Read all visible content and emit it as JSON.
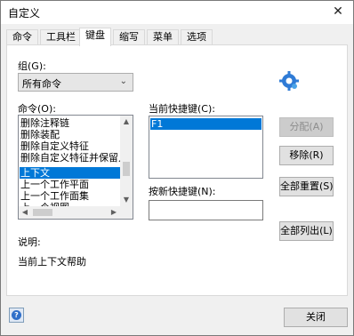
{
  "window": {
    "title": "自定义",
    "close_glyph": "✕"
  },
  "tabs": [
    {
      "label": "命令",
      "active": false
    },
    {
      "label": "工具栏",
      "active": false
    },
    {
      "label": "键盘",
      "active": true
    },
    {
      "label": "缩写",
      "active": false
    },
    {
      "label": "菜单",
      "active": false
    },
    {
      "label": "选项",
      "active": false
    }
  ],
  "group": {
    "label": "组(G):",
    "value": "所有命令"
  },
  "commands": {
    "label": "命令(O):",
    "items": [
      "删除注释链",
      "删除装配",
      "删除自定义特征",
      "删除自定义特征并保留几何",
      "上下文",
      "上一个工作平面",
      "上一个工作面集",
      "上一个视图"
    ],
    "selected_index": 4
  },
  "current_shortcut": {
    "label": "当前快捷键(C):",
    "items": [
      "F1"
    ]
  },
  "new_shortcut": {
    "label": "按新快捷键(N):",
    "value": ""
  },
  "buttons": {
    "assign": "分配(A)",
    "remove": "移除(R)",
    "reset_all": "全部重置(S)",
    "list_all": "全部列出(L)",
    "close": "关闭"
  },
  "description": {
    "label": "说明:",
    "text": "当前上下文帮助"
  },
  "icons": {
    "app": "settings-gear-icon",
    "help": "help-icon"
  },
  "colors": {
    "selection": "#0078d7"
  }
}
